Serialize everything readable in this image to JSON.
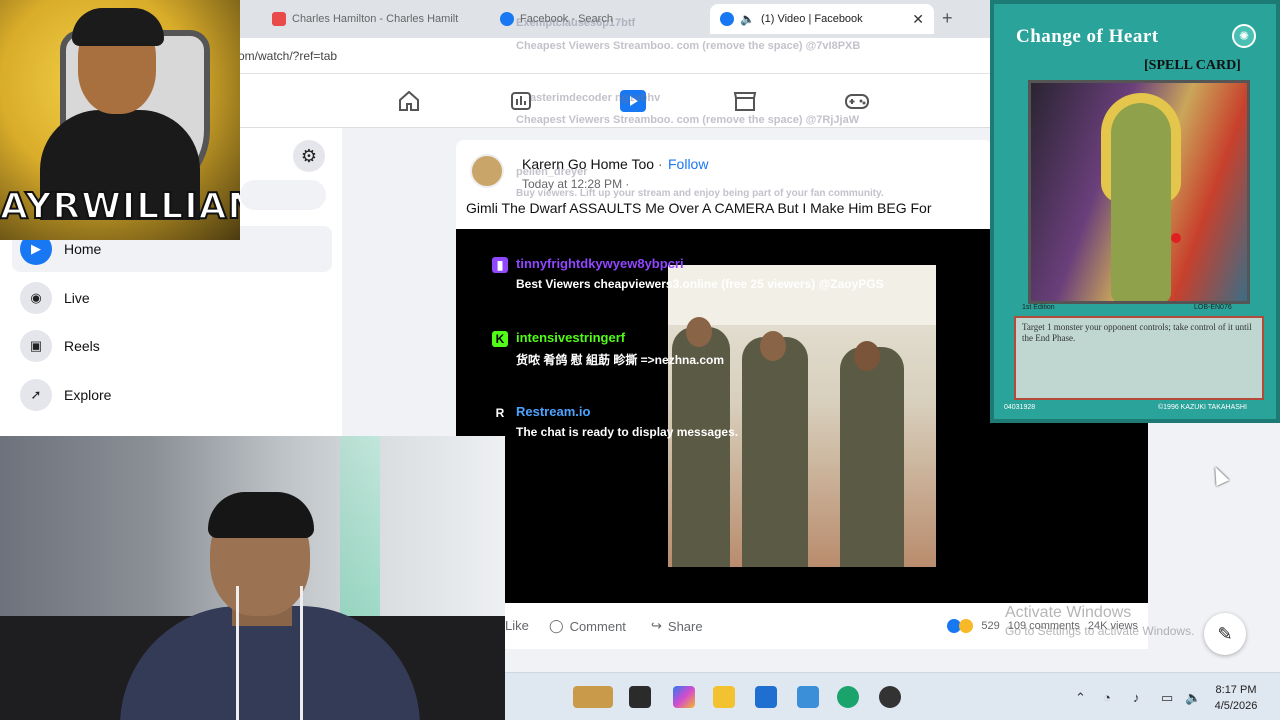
{
  "browser": {
    "tabs": [
      {
        "title": "Charles Hamilton - Charles Hamilt",
        "color": "#e94b4b"
      },
      {
        "title": "Facebook - Search",
        "color": "#1877f2"
      },
      {
        "title": "(1) Video | Facebook",
        "color": "#1877f2",
        "active": true
      }
    ],
    "new_tab": "+",
    "tab_close": "✕",
    "url": "om/watch/?ref=tab"
  },
  "overlay_faint": {
    "line1": "Exemptclauses6p17btf",
    "line2": "Cheapest Viewers Streamboo. com (remove the space) @7vI8PXB",
    "line3": "asterimdecoder ng1ebhv",
    "line4": "Cheapest Viewers Streamboo. com (remove the space) @7RjJjaW",
    "line5": "peilen_dreyer",
    "line6": "Buy viewers. Lift up your stream and enjoy being part of your fan community."
  },
  "sidebar": {
    "settings_icon": "gear-icon",
    "items": [
      {
        "label": "Home",
        "icon": "video-home-icon",
        "active": true
      },
      {
        "label": "Live",
        "icon": "live-icon"
      },
      {
        "label": "Reels",
        "icon": "reels-icon"
      },
      {
        "label": "Explore",
        "icon": "explore-icon"
      }
    ]
  },
  "post": {
    "author": "Karern Go Home Too",
    "separator": "·",
    "follow": "Follow",
    "time": "Today at 12:28 PM ·",
    "title": "Gimli The Dwarf ASSAULTS Me Over A CAMERA But I Make Him BEG For",
    "actions": {
      "like": "Like",
      "comment": "Comment",
      "share": "Share"
    },
    "stats": {
      "reactions": "529",
      "comments": "109 comments",
      "views": "24K views"
    }
  },
  "chat": {
    "messages": [
      {
        "user": "tinnyfrightdkywyew8ybpcri",
        "text": "Best Viewers cheapviewers3.online (free 25 viewers) @ZaoyPGS",
        "platform": "twitch",
        "color": "#9146ff"
      },
      {
        "user": "intensivestringerf",
        "text": "货哝 肴鸽 慰 組莇 畛撕 =>nezhna.com",
        "platform": "kick",
        "color": "#53fc18"
      },
      {
        "user": "Restream.io",
        "text": "The chat is ready to display messages.",
        "platform": "restream",
        "color": "#4da3ff"
      }
    ]
  },
  "streamer_logo": {
    "brand": "AYRWILLIAMS"
  },
  "card": {
    "name": "Change of Heart",
    "type": "[SPELL CARD]",
    "edition": "1st Edition",
    "set_code": "LOB-EN076",
    "text": "Target 1 monster your opponent controls; take control of it until the End Phase.",
    "code": "04031928",
    "copyright": "©1996 KAZUKI TAKAHASHI"
  },
  "windows": {
    "activate_title": "Activate Windows",
    "activate_sub": "Go to Settings to activate Windows.",
    "time": "8:17 PM",
    "date": "4/5/2026"
  },
  "icons": {
    "compose": "compose-icon",
    "colors": {
      "facebook_blue": "#1877f2",
      "twitch_purple": "#9146ff"
    }
  }
}
